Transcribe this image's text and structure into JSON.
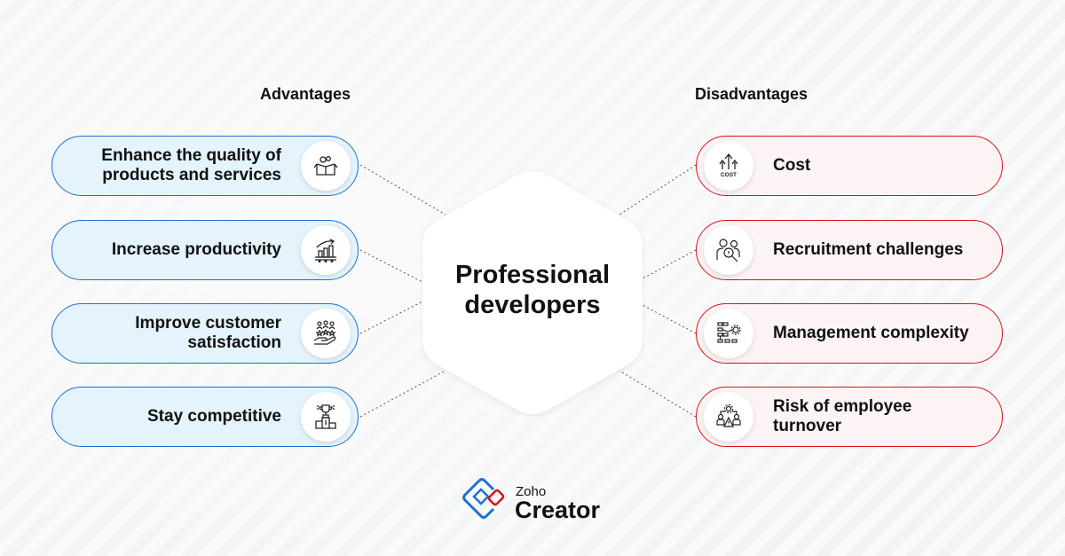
{
  "center": {
    "title_line1": "Professional",
    "title_line2": "developers"
  },
  "advantages": {
    "heading": "Advantages",
    "accent": "#1e6fd0",
    "fill": "#e4f3fc",
    "items": [
      {
        "line1": "Enhance the quality of",
        "line2": "products and services",
        "icon": "box-gears-icon"
      },
      {
        "line1": "Increase productivity",
        "line2": "",
        "icon": "growth-chart-icon"
      },
      {
        "line1": "Improve customer",
        "line2": "satisfaction",
        "icon": "customer-rating-hand-icon"
      },
      {
        "line1": "Stay competitive",
        "line2": "",
        "icon": "trophy-podium-icon"
      }
    ]
  },
  "disadvantages": {
    "heading": "Disadvantages",
    "accent": "#d9121b",
    "fill": "#fcf4f4",
    "items": [
      {
        "line1": "Cost",
        "line2": "",
        "icon": "cost-arrows-icon",
        "icon_text": "COST"
      },
      {
        "line1": "Recruitment challenges",
        "line2": "",
        "icon": "recruitment-search-icon"
      },
      {
        "line1": "Management complexity",
        "line2": "",
        "icon": "workflow-gear-icon"
      },
      {
        "line1": "Risk of employee",
        "line2": "turnover",
        "icon": "team-warning-icon"
      }
    ]
  },
  "logo": {
    "brand": "Zoho",
    "product": "Creator",
    "blue": "#1e6fd0",
    "red": "#d9121b"
  }
}
